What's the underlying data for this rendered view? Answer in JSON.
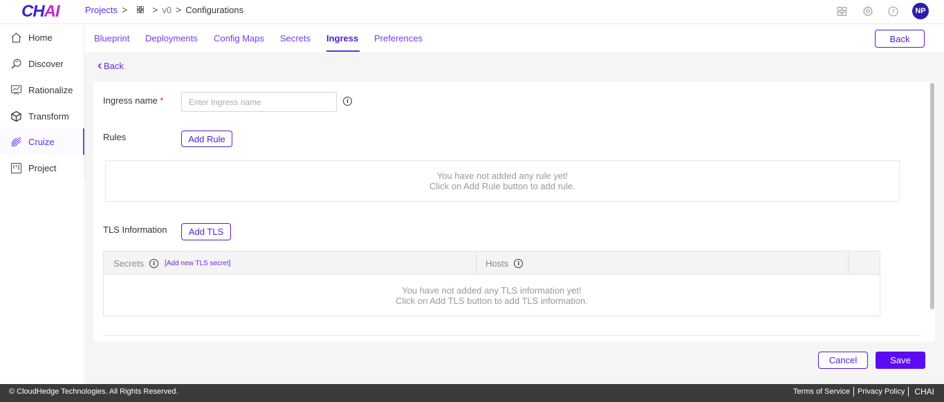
{
  "logo": {
    "text_main": "CH",
    "text_accent": "AI"
  },
  "breadcrumb": {
    "projects": "Projects",
    "sep": ">",
    "version": "v0",
    "current": "Configurations"
  },
  "header": {
    "avatar_initials": "NP"
  },
  "sidebar": {
    "items": [
      {
        "label": "Home",
        "icon": "home-icon"
      },
      {
        "label": "Discover",
        "icon": "discover-icon"
      },
      {
        "label": "Rationalize",
        "icon": "rationalize-icon"
      },
      {
        "label": "Transform",
        "icon": "transform-icon"
      },
      {
        "label": "Cruize",
        "icon": "cruize-icon"
      },
      {
        "label": "Project",
        "icon": "project-icon"
      }
    ],
    "active": "Cruize"
  },
  "tabs": [
    {
      "label": "Blueprint"
    },
    {
      "label": "Deployments"
    },
    {
      "label": "Config Maps"
    },
    {
      "label": "Secrets"
    },
    {
      "label": "Ingress"
    },
    {
      "label": "Preferences"
    }
  ],
  "active_tab": "Ingress",
  "top_back_label": "Back",
  "back_link": "Back",
  "form": {
    "ingress_label": "Ingress name",
    "required_mark": "*",
    "ingress_placeholder": "Enter Ingress name",
    "ingress_value": "",
    "rules_label": "Rules",
    "add_rule_label": "Add Rule",
    "rules_empty_line1": "You have not added any rule yet!",
    "rules_empty_line2": "Click on Add Rule button to add rule.",
    "tls_label": "TLS Information",
    "add_tls_label": "Add TLS",
    "tls_table": {
      "col_secrets": "Secrets",
      "add_secret_link": "[Add new TLS secret]",
      "col_hosts": "Hosts",
      "empty_line1": "You have not added any TLS information yet!",
      "empty_line2": "Click on Add TLS button to add TLS information."
    }
  },
  "actions": {
    "cancel": "Cancel",
    "save": "Save"
  },
  "footer": {
    "copyright": "© CloudHedge Technologies. All Rights Reserved.",
    "terms": "Terms of Service",
    "privacy": "Privacy Policy",
    "brand": "CHAI"
  },
  "colors": {
    "accent": "#5b2ee6",
    "primary_button": "#5b0cf2",
    "footer_bg": "#3b3b3b",
    "avatar_bg": "#2c1ea8"
  }
}
